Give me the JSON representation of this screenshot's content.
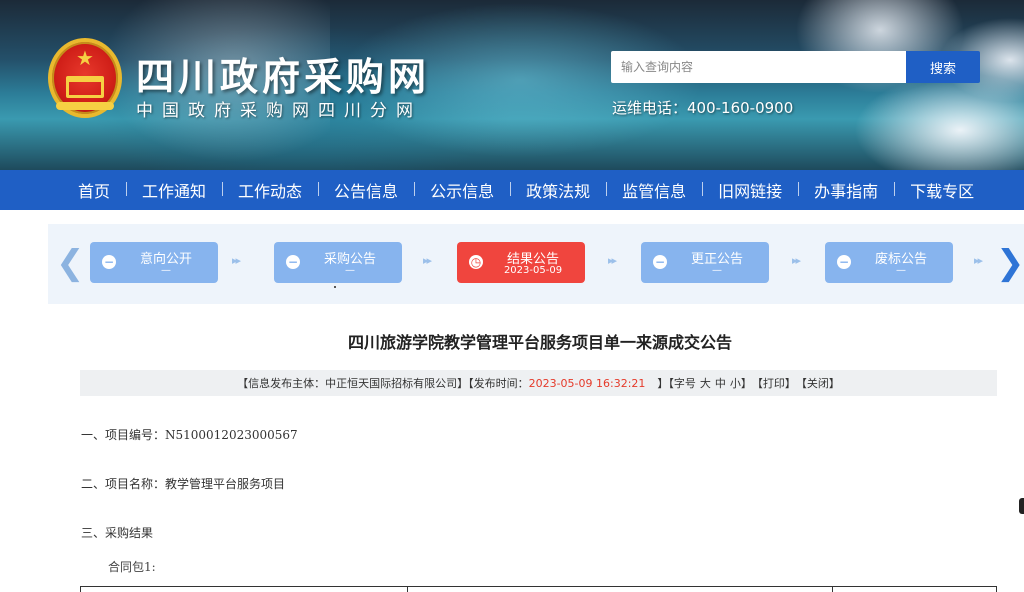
{
  "header": {
    "site_title": "四川政府采购网",
    "site_subtitle": "中国政府采购网四川分网",
    "search_placeholder": "输入查询内容",
    "search_button": "搜索",
    "hotline": "运维电话：400-160-0900"
  },
  "nav": {
    "items": [
      "首页",
      "工作通知",
      "工作动态",
      "公告信息",
      "公示信息",
      "政策法规",
      "监管信息",
      "旧网链接",
      "办事指南",
      "下载专区"
    ]
  },
  "steps": [
    {
      "label": "意向公开",
      "date": "—",
      "state": "inactive"
    },
    {
      "label": "采购公告",
      "date": "—",
      "state": "inactive"
    },
    {
      "label": "结果公告",
      "date": "2023-05-09",
      "state": "active"
    },
    {
      "label": "更正公告",
      "date": "—",
      "state": "inactive"
    },
    {
      "label": "废标公告",
      "date": "—",
      "state": "inactive"
    }
  ],
  "article": {
    "title": "四川旅游学院教学管理平台服务项目单一来源成交公告",
    "meta": {
      "publisher_prefix": "【信息发布主体：",
      "publisher": "中正恒天国际招标有限公司",
      "publisher_suffix": "】【发布时间：",
      "publish_time": "2023-05-09 16:32:21",
      "time_suffix": "】【字号",
      "font_large": "大",
      "font_medium": "中",
      "font_small": "小",
      "font_suffix": "】",
      "print": "【打印】",
      "close": "【关闭】"
    },
    "sections": {
      "project_no": "一、项目编号：N5100012023000567",
      "project_name": "二、项目名称：教学管理平台服务项目",
      "result": "三、采购结果"
    },
    "contract_package": "合同包1:"
  },
  "colors": {
    "nav_bg": "#1f5fc5",
    "step_inactive": "#87b4ee",
    "step_active": "#f0453e",
    "highlight_red": "#e53a2a"
  },
  "icons": {
    "step_inactive": "minus-circle-icon",
    "step_active": "clock-icon",
    "arrow_left": "chevron-left-icon",
    "arrow_right": "chevron-right-icon"
  }
}
